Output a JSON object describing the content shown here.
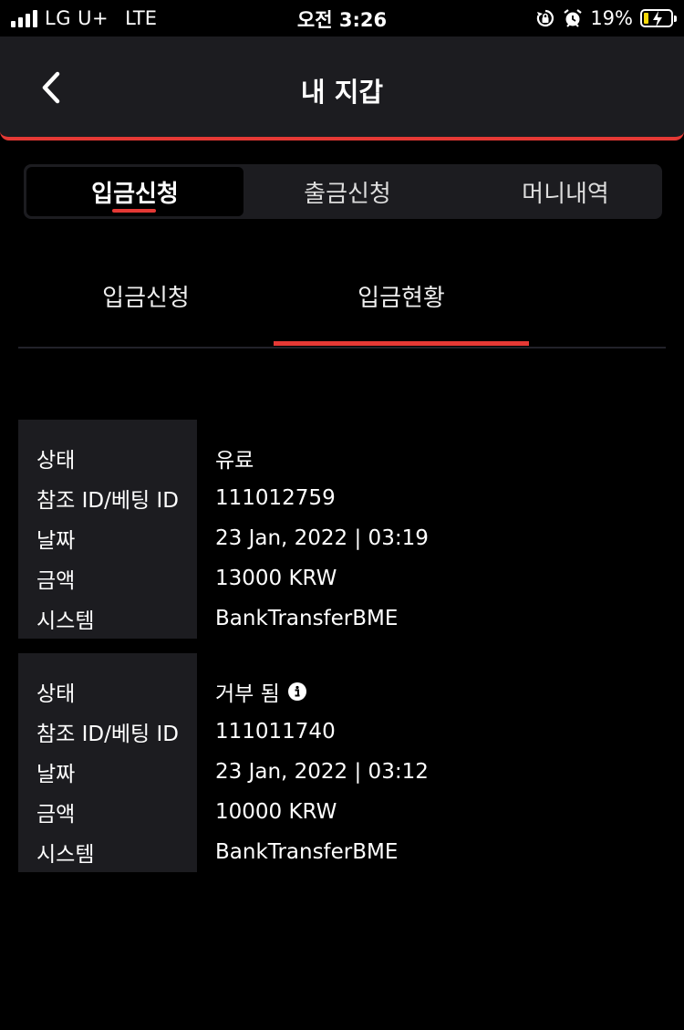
{
  "status_bar": {
    "carrier": "LG U+",
    "network": "LTE",
    "time": "오전 3:26",
    "battery_percent": "19%",
    "battery_level": 0.19,
    "icons": [
      "signal-icon",
      "rotation-lock-icon",
      "alarm-icon",
      "battery-charging-icon"
    ]
  },
  "header": {
    "title": "내 지갑",
    "back_icon": "chevron-left-icon"
  },
  "tabs": [
    {
      "label": "입금신청",
      "active": true
    },
    {
      "label": "출금신청",
      "active": false
    },
    {
      "label": "머니내역",
      "active": false
    }
  ],
  "subtabs": [
    {
      "label": "입금신청",
      "active": false
    },
    {
      "label": "입금현황",
      "active": true
    }
  ],
  "records": [
    {
      "rows": [
        {
          "label": "상태",
          "value": "유료"
        },
        {
          "label": "참조 ID/베팅 ID",
          "value": "111012759"
        },
        {
          "label": "날짜",
          "value": "23 Jan, 2022 | 03:19"
        },
        {
          "label": "금액",
          "value": "13000 KRW"
        },
        {
          "label": "시스템",
          "value": "BankTransferBME"
        }
      ]
    },
    {
      "rows": [
        {
          "label": "상태",
          "value": "거부 됨",
          "icon": "info-icon"
        },
        {
          "label": "참조 ID/베팅 ID",
          "value": "111011740"
        },
        {
          "label": "날짜",
          "value": "23 Jan, 2022 | 03:12"
        },
        {
          "label": "금액",
          "value": "10000 KRW"
        },
        {
          "label": "시스템",
          "value": "BankTransferBME"
        }
      ]
    }
  ],
  "colors": {
    "accent": "#e53935",
    "panel": "#1c1c20",
    "background": "#000000"
  }
}
